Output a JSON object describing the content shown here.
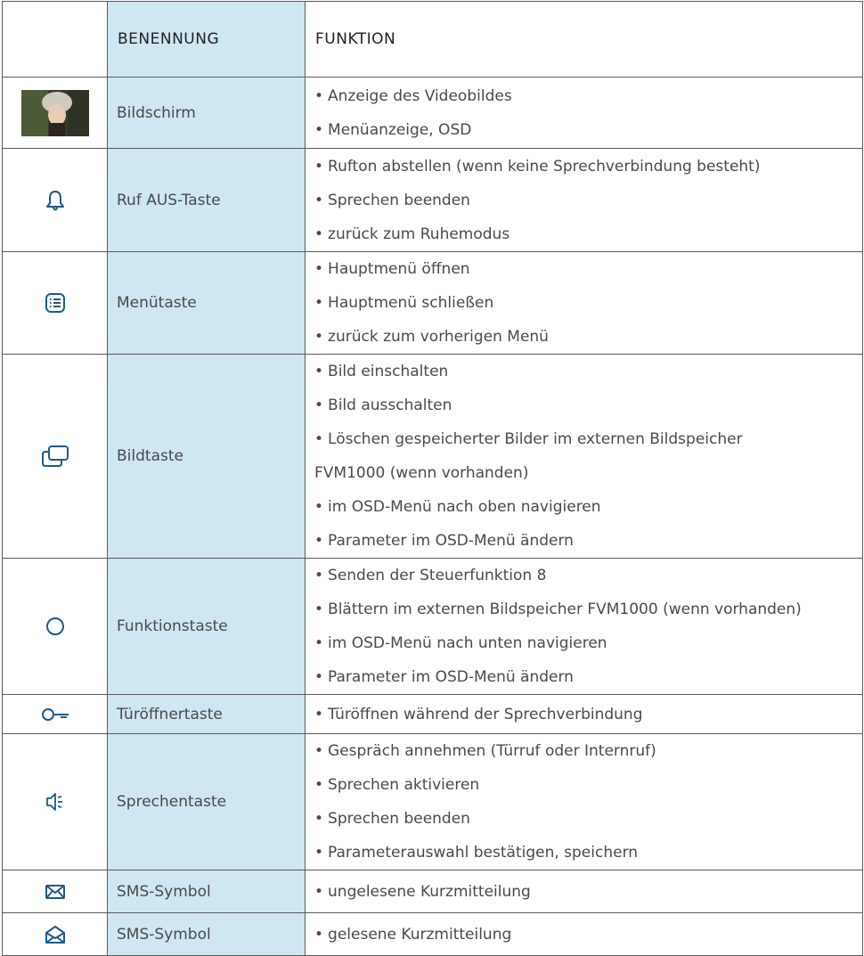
{
  "header": {
    "col_name": "BENENNUNG",
    "col_function": "FUNKTION"
  },
  "rows": [
    {
      "icon": "video-screen-image",
      "name": "Bildschirm",
      "functions": [
        "Anzeige des Videobildes",
        "Menüanzeige, OSD"
      ]
    },
    {
      "icon": "bell-icon",
      "name": "Ruf AUS-Taste",
      "functions": [
        "Rufton abstellen (wenn keine Sprechverbindung besteht)",
        "Sprechen beenden",
        "zurück zum Ruhemodus"
      ]
    },
    {
      "icon": "menu-list-icon",
      "name": "Menütaste",
      "functions": [
        "Hauptmenü öffnen",
        "Hauptmenü schließen",
        "zurück zum vorherigen Menü"
      ]
    },
    {
      "icon": "stacked-screens-icon",
      "name": "Bildtaste",
      "functions": [
        "Bild einschalten",
        "Bild ausschalten",
        "Löschen gespeicherter Bilder im externen Bildspeicher",
        "FVM1000 (wenn vorhanden)",
        "im OSD-Menü nach oben navigieren",
        "Parameter im OSD-Menü ändern"
      ]
    },
    {
      "icon": "circle-icon",
      "name": "Funktionstaste",
      "functions": [
        "Senden der Steuerfunktion 8",
        "Blättern im externen Bildspeicher FVM1000 (wenn vorhanden)",
        "im OSD-Menü nach unten navigieren",
        "Parameter im OSD-Menü ändern"
      ]
    },
    {
      "icon": "key-icon",
      "name": "Türöffnertaste",
      "functions": [
        "Türöffnen während der Sprechverbindung"
      ]
    },
    {
      "icon": "speaker-icon",
      "name": "Sprechentaste",
      "functions": [
        "Gespräch annehmen (Türruf oder Internruf)",
        "Sprechen aktivieren",
        "Sprechen beenden",
        "Parameterauswahl bestätigen, speichern"
      ]
    },
    {
      "icon": "envelope-closed-icon",
      "name": "SMS-Symbol",
      "functions": [
        "ungelesene Kurzmitteilung"
      ]
    },
    {
      "icon": "envelope-open-icon",
      "name": "SMS-Symbol",
      "functions": [
        "gelesene Kurzmitteilung"
      ]
    }
  ]
}
